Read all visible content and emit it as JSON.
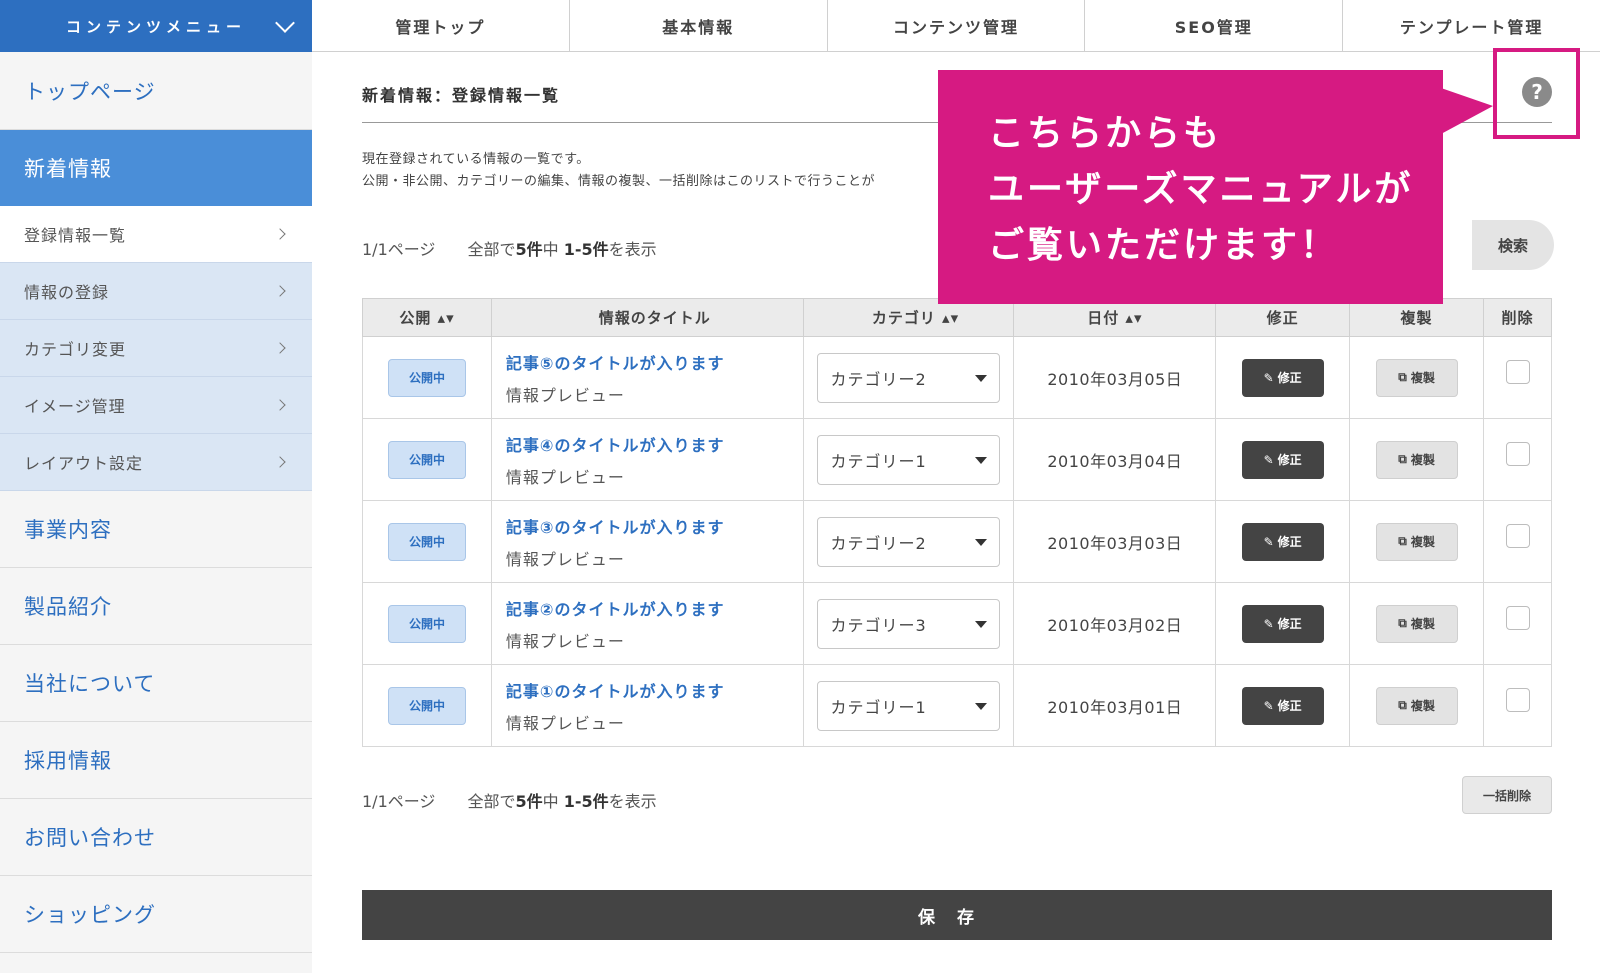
{
  "sidebar": {
    "header": "コンテンツメニュー",
    "top_page": "トップページ",
    "active_section": "新着情報",
    "sub_items": [
      {
        "label": "登録情報一覧"
      },
      {
        "label": "情報の登録"
      },
      {
        "label": "カテゴリ変更"
      },
      {
        "label": "イメージ管理"
      },
      {
        "label": "レイアウト設定"
      }
    ],
    "sections": [
      {
        "label": "事業内容"
      },
      {
        "label": "製品紹介"
      },
      {
        "label": "当社について"
      },
      {
        "label": "採用情報"
      },
      {
        "label": "お問い合わせ"
      },
      {
        "label": "ショッピング"
      }
    ]
  },
  "topnav": {
    "tabs": [
      {
        "label": "管理トップ"
      },
      {
        "label": "基本情報"
      },
      {
        "label": "コンテンツ管理"
      },
      {
        "label": "SEO管理"
      },
      {
        "label": "テンプレート管理"
      }
    ]
  },
  "main": {
    "title": "新着情報：登録情報一覧",
    "help_glyph": "?",
    "desc1": "現在登録されている情報の一覧です。",
    "desc2": "公開・非公開、カテゴリーの編集、情報の複製、一括削除はこのリストで行うことが",
    "pager": {
      "page": "1/1ページ",
      "summary_prefix": "全部で",
      "summary_total": "5件",
      "summary_mid": "中",
      "summary_range": "1-5件",
      "summary_suffix": "を表示"
    },
    "search_button": "検索",
    "table": {
      "headers": {
        "public": "公開 ▴▾",
        "title": "情報のタイトル",
        "category": "カテゴリ ▴▾",
        "date": "日付 ▴▾",
        "edit": "修正",
        "copy": "複製",
        "delete": "削除"
      },
      "rows": [
        {
          "status": "公開中",
          "title": "記事⑤のタイトルが入ります",
          "preview": "情報プレビュー",
          "category": "カテゴリー2",
          "date": "2010年03月05日",
          "edit": "修正",
          "copy": "複製"
        },
        {
          "status": "公開中",
          "title": "記事④のタイトルが入ります",
          "preview": "情報プレビュー",
          "category": "カテゴリー1",
          "date": "2010年03月04日",
          "edit": "修正",
          "copy": "複製"
        },
        {
          "status": "公開中",
          "title": "記事③のタイトルが入ります",
          "preview": "情報プレビュー",
          "category": "カテゴリー2",
          "date": "2010年03月03日",
          "edit": "修正",
          "copy": "複製"
        },
        {
          "status": "公開中",
          "title": "記事②のタイトルが入ります",
          "preview": "情報プレビュー",
          "category": "カテゴリー3",
          "date": "2010年03月02日",
          "edit": "修正",
          "copy": "複製"
        },
        {
          "status": "公開中",
          "title": "記事①のタイトルが入ります",
          "preview": "情報プレビュー",
          "category": "カテゴリー1",
          "date": "2010年03月01日",
          "edit": "修正",
          "copy": "複製"
        }
      ]
    },
    "bulk_delete": "一括削除",
    "save": "保存"
  },
  "callout": {
    "line1": "こちらからも",
    "line2": "ユーザーズマニュアルが",
    "line3": "ご覧いただけます！"
  },
  "icons": {
    "edit": "pencil-icon",
    "copy": "copy-icon",
    "help": "help-icon",
    "menu_toggle": "chevron-down-icon"
  },
  "colors": {
    "brand_blue": "#2d6fc0",
    "active_blue": "#4a8ed8",
    "sub_tint": "#dae6f4",
    "callout_magenta": "#d61a82",
    "dark_button": "#444444"
  }
}
